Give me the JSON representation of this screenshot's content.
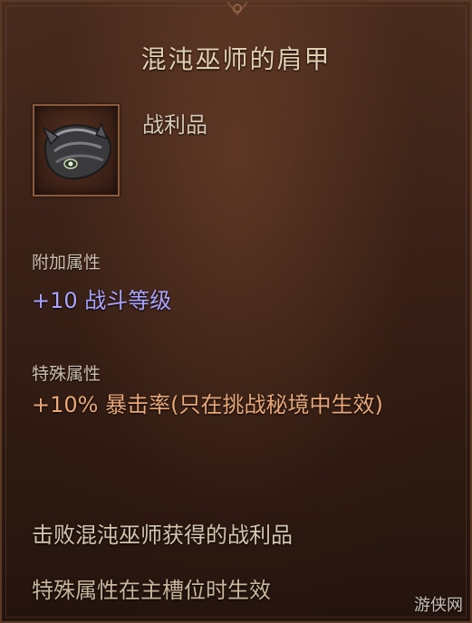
{
  "item": {
    "name": "混沌巫师的肩甲",
    "type": "战利品",
    "icon": "shoulder-armor-icon"
  },
  "sections": {
    "added_label": "附加属性",
    "added_value": "+10 战斗等级",
    "special_label": "特殊属性",
    "special_value": "+10% 暴击率(只在挑战秘境中生效)"
  },
  "flavor": {
    "source": "击败混沌巫师获得的战利品",
    "note": "特殊属性在主槽位时生效"
  },
  "watermark": "游侠网",
  "colors": {
    "background": "#3b2218",
    "border": "#5a3a26",
    "title": "#e0cfb0",
    "blue_affix": "#a8a3ff",
    "orange_affix": "#e9a778"
  }
}
